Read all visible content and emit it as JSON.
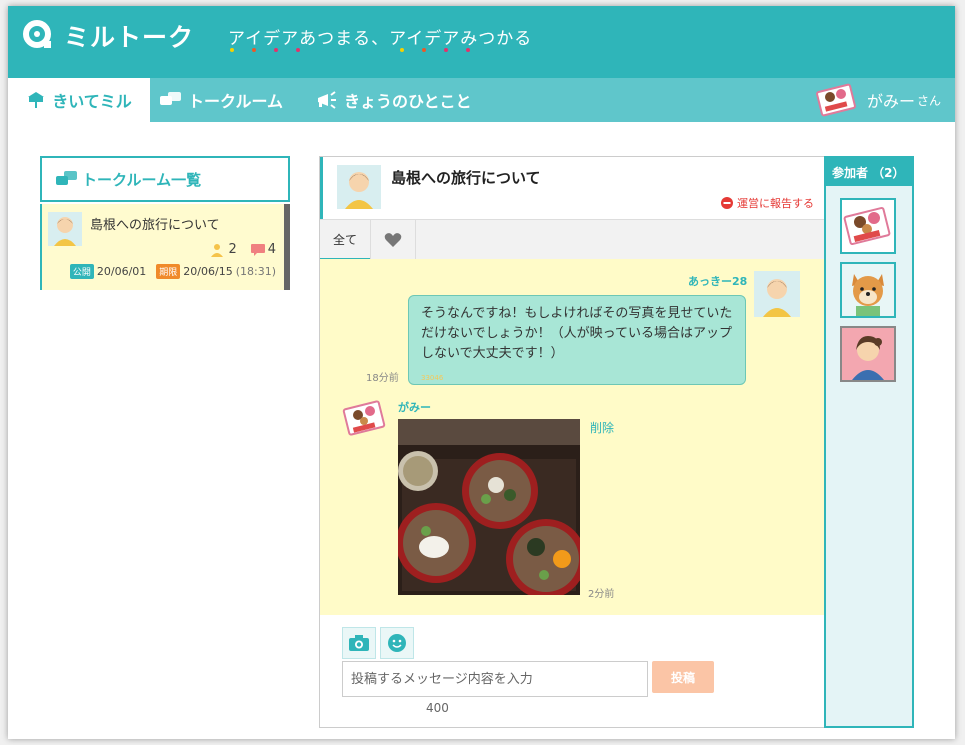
{
  "app": {
    "logo_text": "ミルトーク",
    "tagline": "アイデアあつまる、アイデアみつかる",
    "dot_colors": [
      "#f5d000",
      "#e85a2a",
      "#e2336c",
      "#f5d000",
      "#e85a2a",
      "#e2336c"
    ]
  },
  "nav": {
    "tabs": [
      {
        "label": "きいてミル",
        "icon": "signboard-icon"
      },
      {
        "label": "トークルーム",
        "icon": "speech-bubbles-icon"
      },
      {
        "label": "きょうのひとこと",
        "icon": "megaphone-icon"
      }
    ],
    "user_name": "がみー",
    "user_suffix": "さん"
  },
  "rooms": {
    "heading": "トークルーム一覧",
    "items": [
      {
        "title": "島根への旅行について",
        "members": "2",
        "comments": "4",
        "public_label": "公開",
        "public_date": "20/06/01",
        "deadline_label": "期限",
        "deadline_date": "20/06/15",
        "deadline_time": "(18:31)"
      }
    ]
  },
  "chat": {
    "title": "島根への旅行について",
    "report_label": "運営に報告する",
    "tab_all": "全て",
    "messages": [
      {
        "author": "あっきー28",
        "text_lines": [
          "そうなんですね！もしよければその写真を見せていた",
          "だけないでしょうか！（人が映っている場合はアップ",
          "しないで大丈夫です！）"
        ],
        "sub": "33046",
        "time": "18分前"
      },
      {
        "author": "がみー",
        "delete_label": "削除",
        "time": "2分前"
      }
    ],
    "input_placeholder": "投稿するメッセージ内容を入力",
    "post_label": "投稿",
    "char_count": "400"
  },
  "participants": {
    "heading": "参加者 （2）"
  },
  "colors": {
    "primary": "#2fb5b9",
    "nav": "#5fc6cb",
    "message_bg": "#fffbc8",
    "bubble": "#a8e6d6",
    "report": "#e53935",
    "post_button": "#fbc5a6"
  }
}
